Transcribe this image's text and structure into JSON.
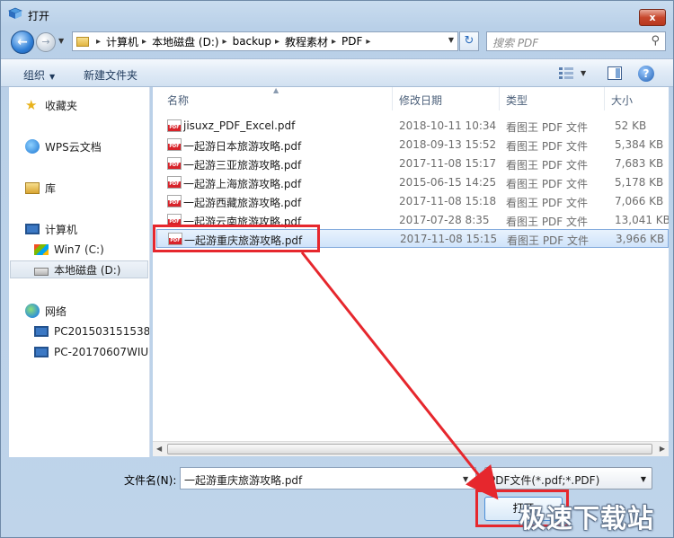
{
  "window": {
    "title": "打开",
    "close_label": "x"
  },
  "address": {
    "crumbs": [
      "计算机",
      "本地磁盘 (D:)",
      "backup",
      "教程素材",
      "PDF"
    ],
    "search_placeholder": "搜索 PDF"
  },
  "toolbar": {
    "organize": "组织",
    "new_folder": "新建文件夹"
  },
  "nav": {
    "favorites": "收藏夹",
    "wps": "WPS云文档",
    "library": "库",
    "computer": "计算机",
    "drive_c": "Win7 (C:)",
    "drive_d": "本地磁盘 (D:)",
    "network": "网络",
    "pc1": "PC201503151538",
    "pc2": "PC-20170607WIUN"
  },
  "columns": {
    "name": "名称",
    "date": "修改日期",
    "type": "类型",
    "size": "大小"
  },
  "files": [
    {
      "name": "jisuxz_PDF_Excel.pdf",
      "date": "2018-10-11 10:34",
      "type": "看图王 PDF 文件",
      "size": "52 KB"
    },
    {
      "name": "一起游日本旅游攻略.pdf",
      "date": "2018-09-13 15:52",
      "type": "看图王 PDF 文件",
      "size": "5,384 KB"
    },
    {
      "name": "一起游三亚旅游攻略.pdf",
      "date": "2017-11-08 15:17",
      "type": "看图王 PDF 文件",
      "size": "7,683 KB"
    },
    {
      "name": "一起游上海旅游攻略.pdf",
      "date": "2015-06-15 14:25",
      "type": "看图王 PDF 文件",
      "size": "5,178 KB"
    },
    {
      "name": "一起游西藏旅游攻略.pdf",
      "date": "2017-11-08 15:18",
      "type": "看图王 PDF 文件",
      "size": "7,066 KB"
    },
    {
      "name": "一起游云南旅游攻略.pdf",
      "date": "2017-07-28 8:35",
      "type": "看图王 PDF 文件",
      "size": "13,041 KB"
    },
    {
      "name": "一起游重庆旅游攻略.pdf",
      "date": "2017-11-08 15:15",
      "type": "看图王 PDF 文件",
      "size": "3,966 KB"
    }
  ],
  "bottom": {
    "filename_label": "文件名(N):",
    "filename_value": "一起游重庆旅游攻略.pdf",
    "filetype_value": "PDF文件(*.pdf;*.PDF)",
    "open_label": "打开"
  },
  "watermark": "极速下载站",
  "colors": {
    "highlight": "#e6272d",
    "selection": "#cfe3fa"
  }
}
